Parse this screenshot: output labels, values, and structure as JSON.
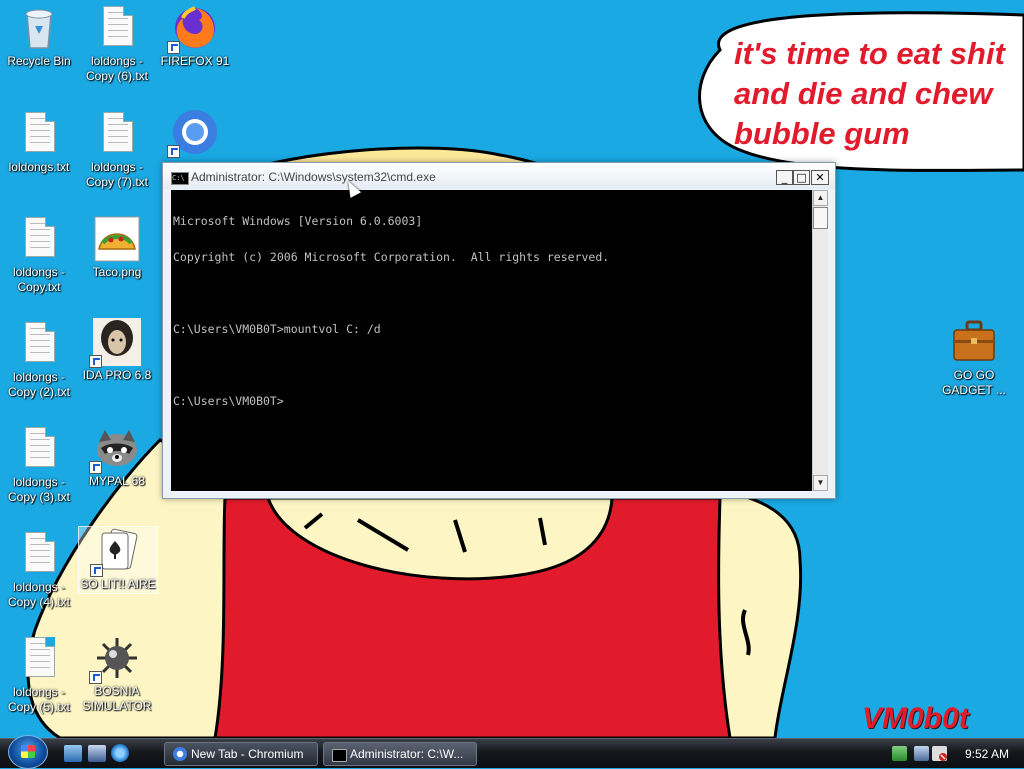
{
  "desktop": {
    "icons": [
      {
        "label": "Recycle Bin",
        "icon": "recycle-bin-icon"
      },
      {
        "label": "loldongs - Copy (6).txt",
        "icon": "text-file-icon"
      },
      {
        "label": "FIREFOX 91",
        "icon": "firefox-icon"
      },
      {
        "label": "loldongs.txt",
        "icon": "text-file-icon"
      },
      {
        "label": "loldongs - Copy (7).txt",
        "icon": "text-file-icon"
      },
      {
        "label": "",
        "icon": "chrome-icon"
      },
      {
        "label": "loldongs - Copy.txt",
        "icon": "text-file-icon"
      },
      {
        "label": "Taco.png",
        "icon": "taco-image-icon"
      },
      {
        "label": "loldongs - Copy (2).txt",
        "icon": "text-file-icon"
      },
      {
        "label": "IDA PRO 6.8",
        "icon": "ida-pro-icon"
      },
      {
        "label": "loldongs - Copy (3).txt",
        "icon": "text-file-icon"
      },
      {
        "label": "MYPAL 68",
        "icon": "raccoon-icon"
      },
      {
        "label": "loldongs - Copy (4).txt",
        "icon": "text-file-icon"
      },
      {
        "label": "SO LIT!! AIRE",
        "icon": "solitaire-icon"
      },
      {
        "label": "loldongs - Copy (5).txt",
        "icon": "text-file-icon"
      },
      {
        "label": "BOSNIA SIMULATOR",
        "icon": "minesweeper-icon"
      },
      {
        "label": "GO GO GADGET ...",
        "icon": "briefcase-icon"
      }
    ]
  },
  "wallpaper": {
    "bubble_text": "it's time to eat shit\nand die and chew\nbubble gum",
    "signature": "VM0b0t",
    "colors": {
      "sky": "#1aa9e3",
      "shirt": "#e21b2c",
      "skin": "#fdf6c4",
      "hair": "#fde89a"
    }
  },
  "cmd_window": {
    "title": "Administrator: C:\\Windows\\system32\\cmd.exe",
    "icon_text": "C:\\",
    "buttons": {
      "minimize": "_",
      "maximize": "□",
      "close": "✕"
    },
    "lines": [
      "Microsoft Windows [Version 6.0.6003]",
      "Copyright (c) 2006 Microsoft Corporation.  All rights reserved.",
      "",
      "C:\\Users\\VM0B0T>mountvol C: /d",
      "",
      "C:\\Users\\VM0B0T>"
    ],
    "scroll_up": "▲",
    "scroll_down": "▼"
  },
  "taskbar": {
    "quicklaunch": [
      "show-desktop-icon",
      "switch-windows-icon",
      "internet-explorer-icon"
    ],
    "buttons": [
      {
        "label": "New Tab - Chromium",
        "icon": "chromium-icon"
      },
      {
        "label": "Administrator: C:\\W...",
        "icon": "cmd-icon"
      }
    ],
    "tray_icons": [
      "network-icon",
      "display-icon",
      "volume-muted-icon"
    ],
    "clock": "9:52 AM"
  }
}
